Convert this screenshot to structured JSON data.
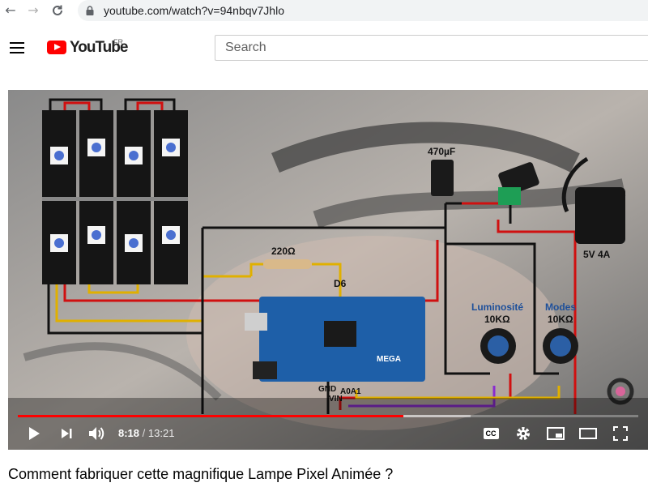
{
  "browser": {
    "url": "youtube.com/watch?v=94nbqv7Jhlo",
    "back_icon": "arrow-left-icon",
    "forward_icon": "arrow-right-icon",
    "reload_icon": "reload-icon",
    "lock_icon": "lock-icon"
  },
  "header": {
    "logo_text": "YouTube",
    "region": "FR",
    "search_placeholder": "Search",
    "menu_icon": "hamburger-icon",
    "brand_color": "#ff0000"
  },
  "video": {
    "current_time": "8:18",
    "duration": "13:21",
    "progress_fraction": 0.621,
    "buffered_fraction": 0.73,
    "diagram_labels": {
      "capacitor": "470µF",
      "resistor": "220Ω",
      "data_pin": "D6",
      "power_supply": "5V 4A",
      "pot_luminosity": "Luminosité",
      "pot_luminosity_value": "10KΩ",
      "pot_modes": "Modes",
      "pot_modes_value": "10KΩ",
      "gnd": "GND",
      "vin": "VIN",
      "a0a1": "A0A1",
      "board_name": "MEGA"
    }
  },
  "controls": {
    "play_icon": "play-icon",
    "next_icon": "next-icon",
    "volume_icon": "volume-icon",
    "cc_label": "CC",
    "settings_icon": "gear-icon",
    "miniplayer_icon": "miniplayer-icon",
    "theater_icon": "theater-icon",
    "fullscreen_icon": "fullscreen-icon"
  },
  "title": "Comment fabriquer cette magnifique Lampe Pixel Animée ?"
}
